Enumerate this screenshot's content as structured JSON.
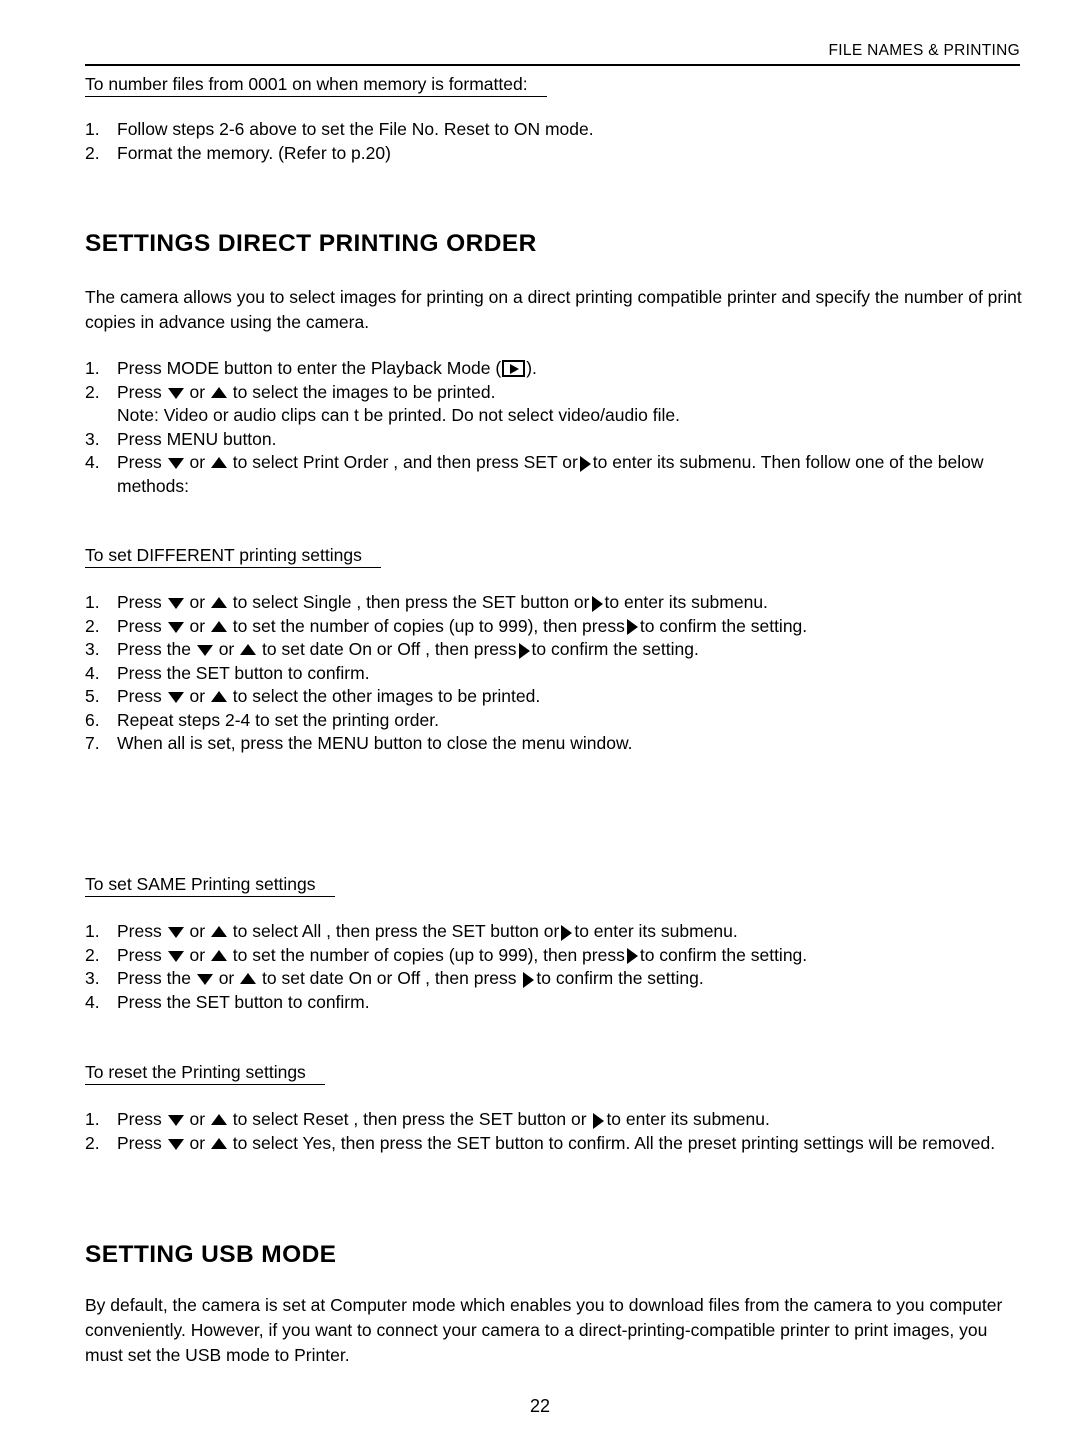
{
  "header": {
    "title": "FILE NAMES & PRINTING"
  },
  "intro_section": {
    "subhead": "To number files from 0001 on when memory is formatted:",
    "steps": [
      {
        "num": "1.",
        "text": "Follow steps 2-6 above to set the File No. Reset to ON mode."
      },
      {
        "num": "2.",
        "text": "Format the memory. (Refer to p.20)"
      }
    ]
  },
  "print_order_section": {
    "heading": "SETTINGS DIRECT PRINTING ORDER",
    "paragraph": "The camera allows you to select images for printing on a direct printing compatible printer and specify the number of print copies in advance using the camera.",
    "steps": {
      "s1_a": "Press MODE button to enter the Playback Mode (",
      "s1_b": ").",
      "s1_num": "1.",
      "s2_num": "2.",
      "s2_a": "Press",
      "s2_b": "or",
      "s2_c": "to select the images to be printed.",
      "note": "Note: Video or audio clips can t be printed. Do not select video/audio file.",
      "s3_num": "3.",
      "s3_text": "Press MENU button.",
      "s4_num": "4.",
      "s4_a": "Press",
      "s4_b": "or",
      "s4_c": "to select Print Order , and then press SET or",
      "s4_d": "to enter its submenu. Then follow one of the below methods:"
    }
  },
  "different_section": {
    "subhead": "To set DIFFERENT printing settings",
    "items": {
      "i1_num": "1.",
      "i1_a": "Press",
      "i1_b": "or",
      "i1_c": "to select Single , then press the SET button or",
      "i1_d": "to enter its submenu.",
      "i2_num": "2.",
      "i2_a": "Press",
      "i2_b": "or",
      "i2_c": "to set the number of copies (up to 999), then press",
      "i2_d": "to confirm the setting.",
      "i3_num": "3.",
      "i3_a": "Press the",
      "i3_b": "or",
      "i3_c": "to set date On or Off , then press",
      "i3_d": "to confirm the setting.",
      "i4_num": "4.",
      "i4_text": "Press the SET button to confirm.",
      "i5_num": "5.",
      "i5_a": "Press",
      "i5_b": "or",
      "i5_c": "to select the other images to be printed.",
      "i6_num": "6.",
      "i6_text": "Repeat steps 2-4 to set the printing order.",
      "i7_num": "7.",
      "i7_text": "When all is set, press the MENU button to close the menu window."
    }
  },
  "same_section": {
    "subhead": "To set SAME Printing settings",
    "items": {
      "i1_num": "1.",
      "i1_a": "Press",
      "i1_b": "or",
      "i1_c": "to select All , then press the SET button or",
      "i1_d": "to enter its submenu.",
      "i2_num": "2.",
      "i2_a": "Press",
      "i2_b": "or",
      "i2_c": "to set the number of copies (up to 999), then press",
      "i2_d": "to confirm the setting.",
      "i3_num": "3.",
      "i3_a": "Press the",
      "i3_b": "or",
      "i3_c": "to set date On or Off , then press",
      "i3_d": "to confirm the setting.",
      "i4_num": "4.",
      "i4_text": "Press the SET button to confirm."
    }
  },
  "reset_section": {
    "subhead": "To reset the Printing settings",
    "items": {
      "i1_num": "1.",
      "i1_a": "Press",
      "i1_b": "or",
      "i1_c": "to select Reset , then press the SET button or",
      "i1_d": "to enter its submenu.",
      "i2_num": "2.",
      "i2_a": "Press",
      "i2_b": "or",
      "i2_c": "to select Yes, then press the SET button to confirm. All the preset printing settings will be removed."
    }
  },
  "usb_section": {
    "heading": "SETTING USB MODE",
    "paragraph": "By default, the camera is set at Computer mode which enables you to download files from the camera to you computer conveniently. However, if you want to connect your camera to a direct-printing-compatible printer to print images, you must set the USB mode to Printer."
  },
  "footer": {
    "page_number": "22"
  },
  "icons": {
    "playback": "playback-icon",
    "down": "triangle-down-icon",
    "up": "triangle-up-icon",
    "right": "triangle-right-icon"
  }
}
